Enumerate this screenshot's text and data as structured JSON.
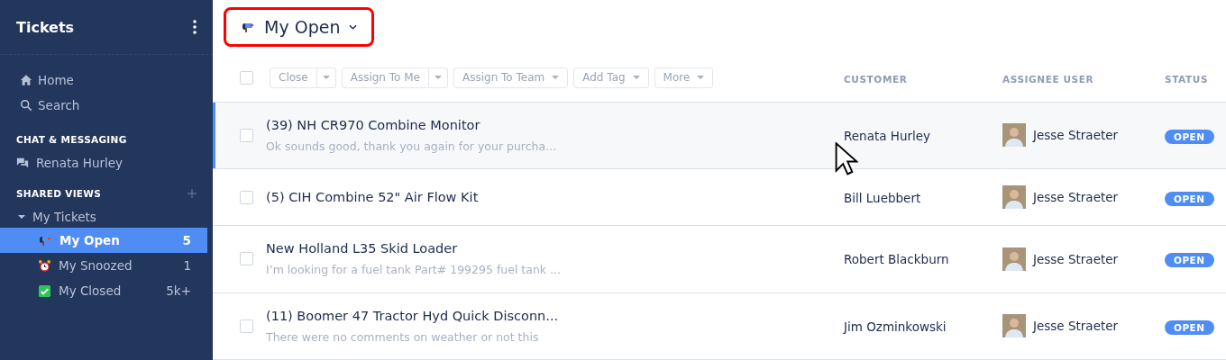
{
  "sidebar": {
    "title": "Tickets",
    "nav": [
      {
        "label": "Home",
        "kind": "home"
      },
      {
        "label": "Search",
        "kind": "search"
      }
    ],
    "sections": [
      {
        "title": "CHAT & MESSAGING",
        "add": false,
        "items": [
          {
            "label": "Renata Hurley",
            "kind": "chat"
          }
        ]
      },
      {
        "title": "SHARED VIEWS",
        "add": true,
        "tree": [
          {
            "label": "My Tickets",
            "expanded": true,
            "children": [
              {
                "label": "My Open",
                "count": "5",
                "kind": "mailbox",
                "selected": true
              },
              {
                "label": "My Snoozed",
                "count": "1",
                "kind": "alarm",
                "selected": false
              },
              {
                "label": "My Closed",
                "count": "5k+",
                "kind": "check",
                "selected": false
              }
            ]
          }
        ]
      }
    ]
  },
  "view": {
    "title": "My Open",
    "highlighted": true
  },
  "toolbar": {
    "select_all": false,
    "buttons": [
      {
        "label": "Close",
        "split": true,
        "disabled": true
      },
      {
        "label": "Assign To Me",
        "split": true,
        "disabled": true
      },
      {
        "label": "Assign To Team",
        "split": false,
        "disabled": true
      },
      {
        "label": "Add Tag",
        "split": false,
        "disabled": true
      },
      {
        "label": "More",
        "split": false,
        "disabled": true
      }
    ]
  },
  "table": {
    "columns": [
      "CUSTOMER",
      "ASSIGNEE USER",
      "STATUS"
    ],
    "rows": [
      {
        "title": "(39) NH CR970 Combine Monitor",
        "snippet": "Ok sounds good, thank you again for your purcha...",
        "customer": "Renata Hurley",
        "assignee": "Jesse Straeter",
        "status": "OPEN",
        "selected": true,
        "checked": false
      },
      {
        "title": "(5) CIH Combine 52\" Air Flow Kit",
        "customer": "Bill Luebbert",
        "assignee": "Jesse Straeter",
        "status": "OPEN",
        "selected": false,
        "checked": false
      },
      {
        "title": "New Holland L35 Skid Loader",
        "snippet": "I’m looking for a fuel tank Part# 199295 fuel tank ...",
        "customer": "Robert Blackburn",
        "assignee": "Jesse Straeter",
        "status": "OPEN",
        "selected": false,
        "checked": false
      },
      {
        "title": "(11) Boomer 47 Tractor Hyd Quick Disconn...",
        "snippet": "There were no comments on weather or not this",
        "customer": "Jim Ozminkowski",
        "assignee": "Jesse Straeter",
        "status": "OPEN",
        "selected": false,
        "checked": false
      }
    ]
  }
}
